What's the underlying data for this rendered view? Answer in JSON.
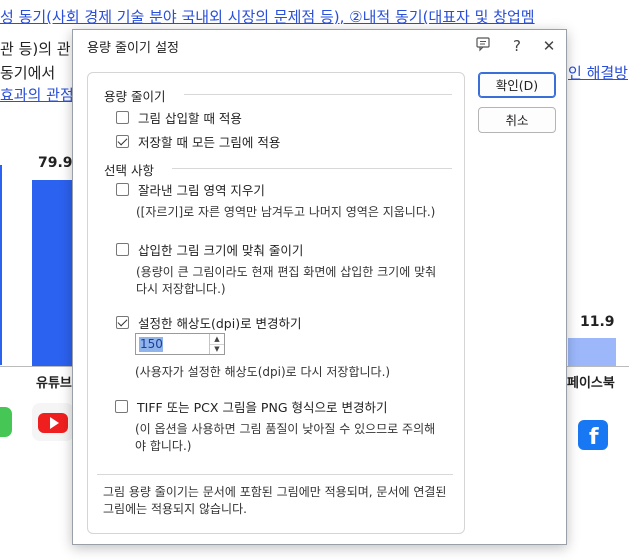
{
  "background": {
    "doc_lines": [
      {
        "text_left": "성 동기(사회 경제 기술 분야 국내외 시장의 문제점 등), ②내적 동기(대표자 및 창업멤",
        "right": ""
      },
      {
        "text_left": "관 등)의 관",
        "right": ""
      },
      {
        "text_left": "동기에서",
        "right": "인 해결방"
      },
      {
        "text_left": "효과의 관점",
        "right": ""
      }
    ],
    "chart_values": [
      "79.9",
      "11.9"
    ],
    "chart_labels": [
      "유튜브",
      "페이스북"
    ]
  },
  "dialog": {
    "title": "용량 줄이기 설정",
    "titlebar_icons": [
      "comment-icon",
      "help-icon",
      "close-icon"
    ],
    "sections": {
      "reduce": {
        "heading": "용량 줄이기",
        "options": [
          {
            "label": "그림 삽입할 때 적용",
            "checked": false
          },
          {
            "label": "저장할 때 모든 그림에 적용",
            "checked": true
          }
        ]
      },
      "select": {
        "heading": "선택 사항",
        "options": [
          {
            "label": "잘라낸 그림 영역 지우기",
            "checked": false,
            "desc": [
              "([자르기]로 자른 영역만 남겨두고 나머지 영역은 지웁니다.)"
            ]
          },
          {
            "label": "삽입한 그림 크기에 맞춰 줄이기",
            "checked": false,
            "desc": [
              "(용량이 큰 그림이라도 현재 편집 화면에 삽입한 크기에 맞춰",
              "다시 저장합니다.)"
            ]
          },
          {
            "label": "설정한 해상도(dpi)로 변경하기",
            "checked": true,
            "desc": [
              "(사용자가 설정한 해상도(dpi)로 다시 저장합니다.)"
            ]
          },
          {
            "label": "TIFF 또는 PCX 그림을 PNG 형식으로 변경하기",
            "checked": false,
            "desc": [
              "(이 옵션을 사용하면 그림 품질이 낮아질 수 있으므로 주의해",
              "야 합니다.)"
            ]
          }
        ]
      }
    },
    "dpi_value": "150",
    "footer_note": [
      "그림 용량 줄이기는 문서에 포함된 그림에만 적용되며, 문서에 연결된",
      "그림에는 적용되지 않습니다."
    ],
    "buttons": {
      "ok": "확인(D)",
      "cancel": "취소"
    }
  }
}
